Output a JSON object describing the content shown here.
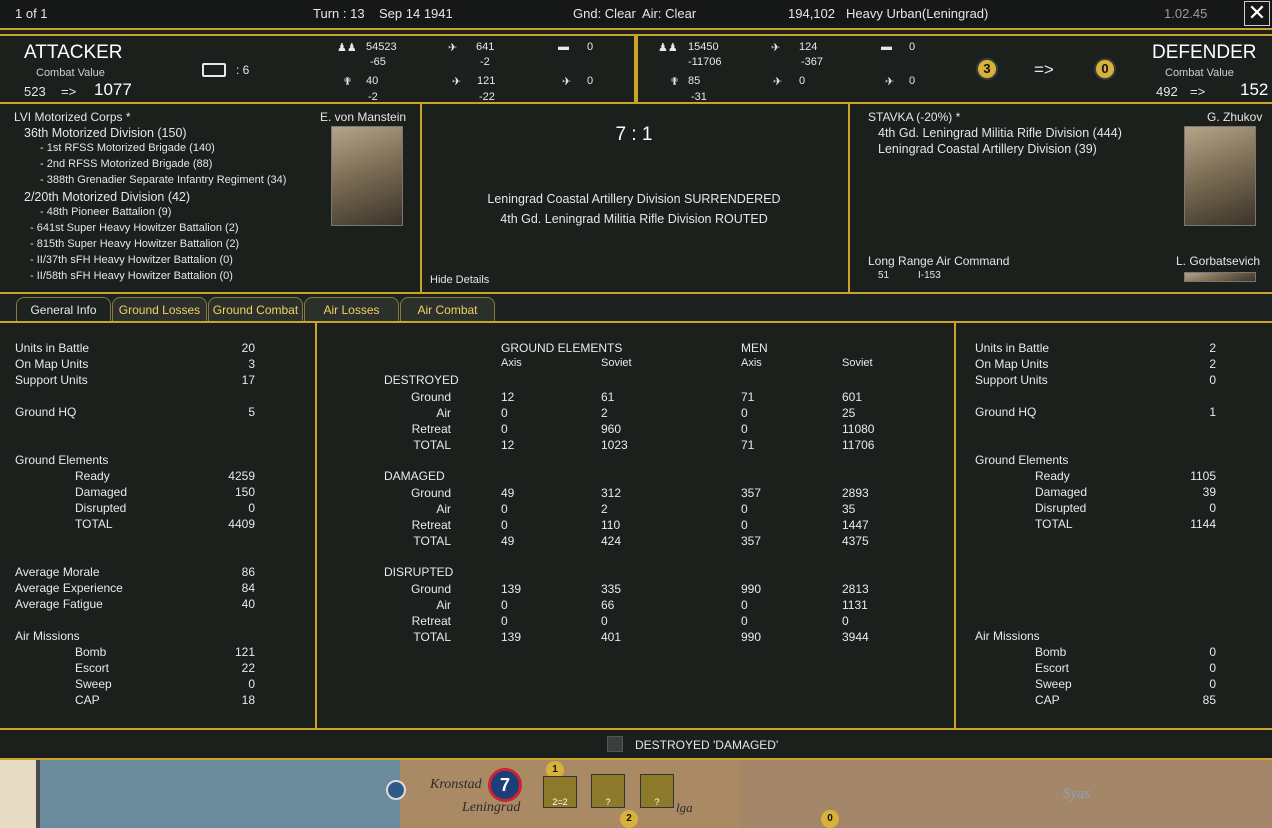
{
  "topbar": {
    "page": "1 of 1",
    "turn": "Turn : 13",
    "date": "Sep 14 1941",
    "gnd": "Gnd: Clear",
    "air": "Air: Clear",
    "hex_id": "194,102",
    "terrain": "Heavy Urban(Leningrad)",
    "version": "1.02.45",
    "close_glyph": "✕"
  },
  "attacker": {
    "title": "ATTACKER",
    "cv_label": "Combat Value",
    "cv_from": "523",
    "arrow": "=>",
    "cv_to": "1077",
    "hq_label": ": 6",
    "men": "54523",
    "men_loss": "-65",
    "guns": "40",
    "guns_loss": "-2",
    "afv": "0",
    "fighters": "641",
    "fighters_loss": "-2",
    "bombers": "121",
    "bombers_loss": "-22",
    "recon": "0"
  },
  "defender": {
    "title": "DEFENDER",
    "cv_label": "Combat Value",
    "cv_from": "492",
    "arrow": "=>",
    "cv_to": "152",
    "men": "15450",
    "men_loss": "-11706",
    "guns": "85",
    "guns_loss": "-31",
    "afv": "0",
    "fighters": "124",
    "fighters_loss": "-367",
    "bombers": "0",
    "recon": "0",
    "fort_from": "3",
    "fort_arrow": "=>",
    "fort_to": "0"
  },
  "attacker_units": {
    "corps": "LVI Motorized Corps *",
    "leader": "E. von Manstein",
    "lines": [
      "36th Motorized Division (150)",
      "- 1st RFSS Motorized Brigade (140)",
      "- 2nd RFSS Motorized Brigade (88)",
      "- 388th Grenadier Separate Infantry Regiment (34)",
      "2/20th Motorized Division (42)",
      "- 48th Pioneer Battalion (9)",
      "- 641st Super Heavy Howitzer Battalion (2)",
      "- 815th Super Heavy Howitzer Battalion (2)",
      "- II/37th sFH Heavy Howitzer Battalion (0)",
      "- II/58th sFH Heavy Howitzer Battalion (0)"
    ]
  },
  "result": {
    "odds": "7 : 1",
    "line1": "Leningrad Coastal Artillery Division SURRENDERED",
    "line2": "4th Gd. Leningrad Militia Rifle Division ROUTED",
    "hide": "Hide Details"
  },
  "defender_units": {
    "front": "STAVKA (-20%) *",
    "leader": "G. Zhukov",
    "lines": [
      "4th Gd. Leningrad Militia Rifle Division (444)",
      "Leningrad Coastal Artillery Division (39)"
    ],
    "air_cmd": "Long Range Air Command",
    "air_leader": "L. Gorbatsevich",
    "air_num": "51",
    "air_type": "I-153"
  },
  "tabs": [
    "General Info",
    "Ground Losses",
    "Ground Combat",
    "Air Losses",
    "Air Combat"
  ],
  "left_stats": {
    "units_in_battle": [
      "Units in Battle",
      "20"
    ],
    "on_map": [
      "On Map Units",
      "3"
    ],
    "support": [
      "Support Units",
      "17"
    ],
    "hq": [
      "Ground HQ",
      "5"
    ],
    "ge_title": "Ground Elements",
    "ready": [
      "Ready",
      "4259"
    ],
    "damaged": [
      "Damaged",
      "150"
    ],
    "disrupted": [
      "Disrupted",
      "0"
    ],
    "total": [
      "TOTAL",
      "4409"
    ],
    "morale": [
      "Average Morale",
      "86"
    ],
    "experience": [
      "Average Experience",
      "84"
    ],
    "fatigue": [
      "Average Fatigue",
      "40"
    ],
    "air_title": "Air Missions",
    "bomb": [
      "Bomb",
      "121"
    ],
    "escort": [
      "Escort",
      "22"
    ],
    "sweep": [
      "Sweep",
      "0"
    ],
    "cap": [
      "CAP",
      "18"
    ]
  },
  "right_stats": {
    "units_in_battle": [
      "Units in Battle",
      "2"
    ],
    "on_map": [
      "On Map Units",
      "2"
    ],
    "support": [
      "Support Units",
      "0"
    ],
    "hq": [
      "Ground HQ",
      "1"
    ],
    "ge_title": "Ground Elements",
    "ready": [
      "Ready",
      "1105"
    ],
    "damaged": [
      "Damaged",
      "39"
    ],
    "disrupted": [
      "Disrupted",
      "0"
    ],
    "total": [
      "TOTAL",
      "1144"
    ],
    "air_title": "Air Missions",
    "bomb": [
      "Bomb",
      "0"
    ],
    "escort": [
      "Escort",
      "0"
    ],
    "sweep": [
      "Sweep",
      "0"
    ],
    "cap": [
      "CAP",
      "85"
    ]
  },
  "losses": {
    "hdr_ge": "GROUND ELEMENTS",
    "hdr_men": "MEN",
    "axis": "Axis",
    "soviet": "Soviet",
    "groups": [
      {
        "title": "DESTROYED",
        "rows": [
          [
            "Ground",
            "12",
            "61",
            "71",
            "601"
          ],
          [
            "Air",
            "0",
            "2",
            "0",
            "25"
          ],
          [
            "Retreat",
            "0",
            "960",
            "0",
            "11080"
          ],
          [
            "TOTAL",
            "12",
            "1023",
            "71",
            "11706"
          ]
        ]
      },
      {
        "title": "DAMAGED",
        "rows": [
          [
            "Ground",
            "49",
            "312",
            "357",
            "2893"
          ],
          [
            "Air",
            "0",
            "2",
            "0",
            "35"
          ],
          [
            "Retreat",
            "0",
            "110",
            "0",
            "1447"
          ],
          [
            "TOTAL",
            "49",
            "424",
            "357",
            "4375"
          ]
        ]
      },
      {
        "title": "DISRUPTED",
        "rows": [
          [
            "Ground",
            "139",
            "335",
            "990",
            "2813"
          ],
          [
            "Air",
            "0",
            "66",
            "0",
            "1131"
          ],
          [
            "Retreat",
            "0",
            "0",
            "0",
            "0"
          ],
          [
            "TOTAL",
            "139",
            "401",
            "990",
            "3944"
          ]
        ]
      }
    ]
  },
  "footer": {
    "checkbox_label": "DESTROYED 'DAMAGED'"
  },
  "map": {
    "label_kronstadt": "Kronstad",
    "label_leningrad": "Leningrad",
    "label_syas": "Syas",
    "label_lga": "lga",
    "counter1": "7",
    "counter2_top": "1",
    "counter2_bottom": "2=2",
    "counter3": "?",
    "counter4": "?",
    "counter5": "2",
    "counter6": "0"
  }
}
